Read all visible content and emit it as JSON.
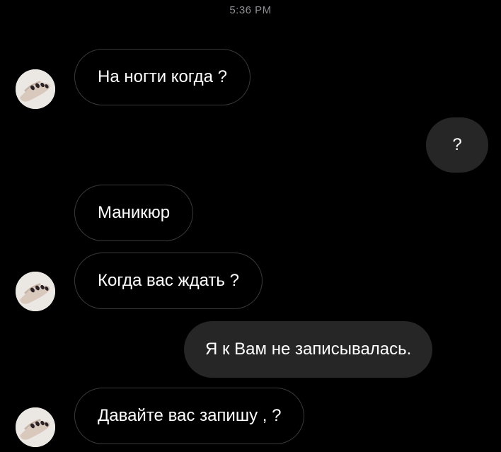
{
  "status": {
    "time": "5:36 PM"
  },
  "messages": [
    {
      "from": "contact",
      "text": "На ногти когда ?"
    },
    {
      "from": "me",
      "text": "?"
    },
    {
      "from": "contact",
      "text": "Маникюр"
    },
    {
      "from": "contact",
      "text": "Когда вас ждать ?"
    },
    {
      "from": "me",
      "text": "Я к Вам не записывалась."
    },
    {
      "from": "contact",
      "text": "Давайте вас запишу , ?"
    }
  ],
  "avatar": {
    "icon": "manicured-hand-icon"
  },
  "colors": {
    "background": "#000000",
    "incoming_border": "#3a3a3c",
    "outgoing_fill": "#262626",
    "timestamp": "#8e8e93"
  }
}
